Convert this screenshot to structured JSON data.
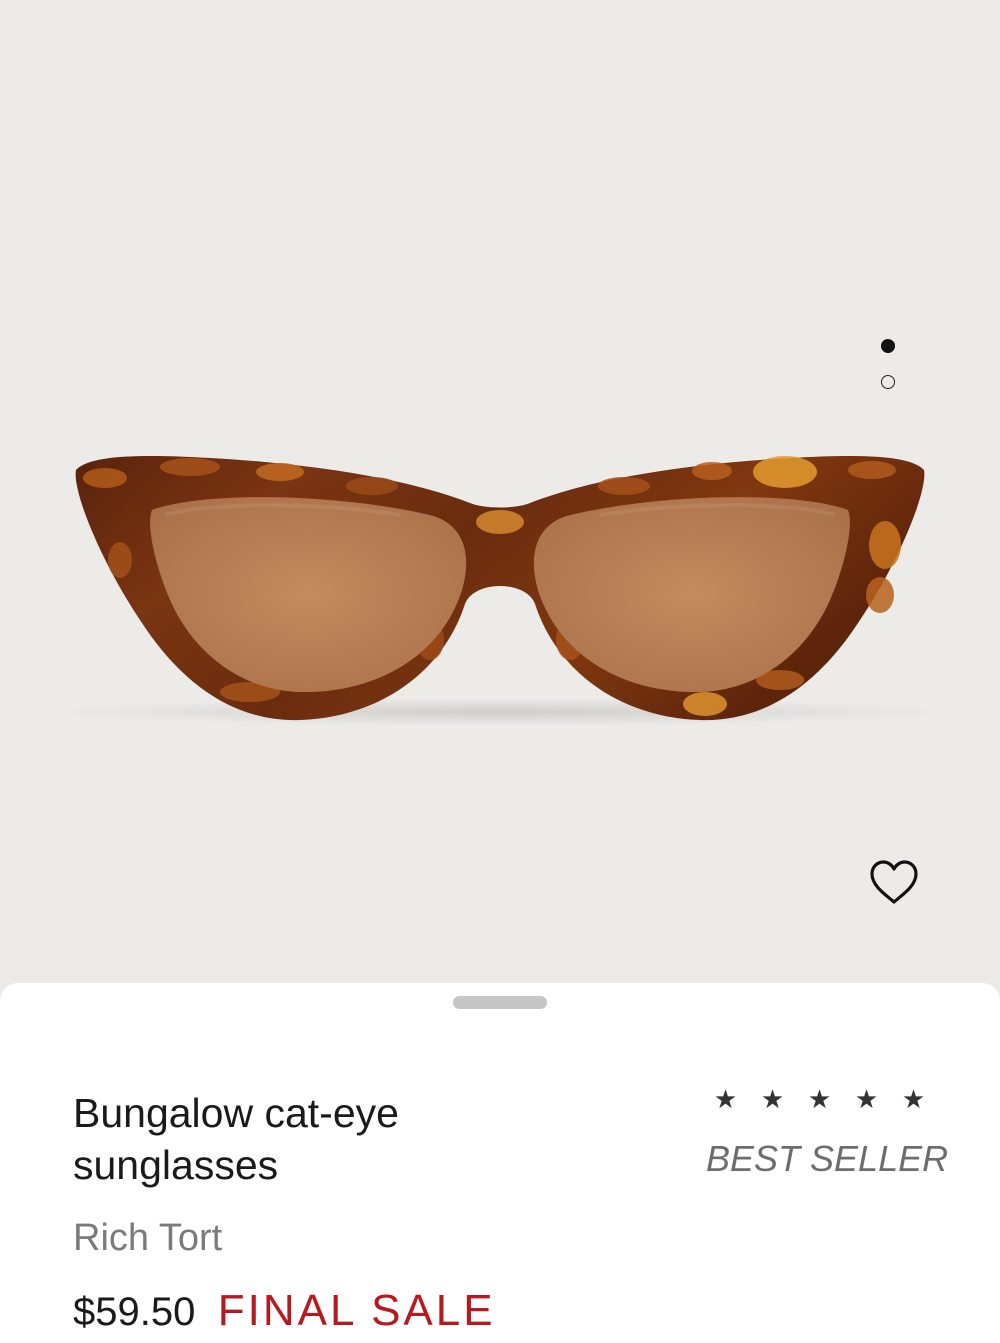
{
  "product": {
    "title": "Bungalow cat-eye sunglasses",
    "color": "Rich Tort",
    "price": "$59.50",
    "sale_label": "FINAL SALE",
    "badge": "BEST SELLER",
    "rating_stars": [
      "★",
      "★",
      "★",
      "★",
      "★"
    ]
  },
  "gallery": {
    "image_count": 2,
    "active_index": 0
  },
  "icons": {
    "favorite": "heart-outline-icon"
  },
  "colors": {
    "hero_background": "#ecebe8",
    "sale_red": "#b8191f",
    "tortoise_dark": "#6b2c0d",
    "lens_brown": "#bb825a"
  }
}
